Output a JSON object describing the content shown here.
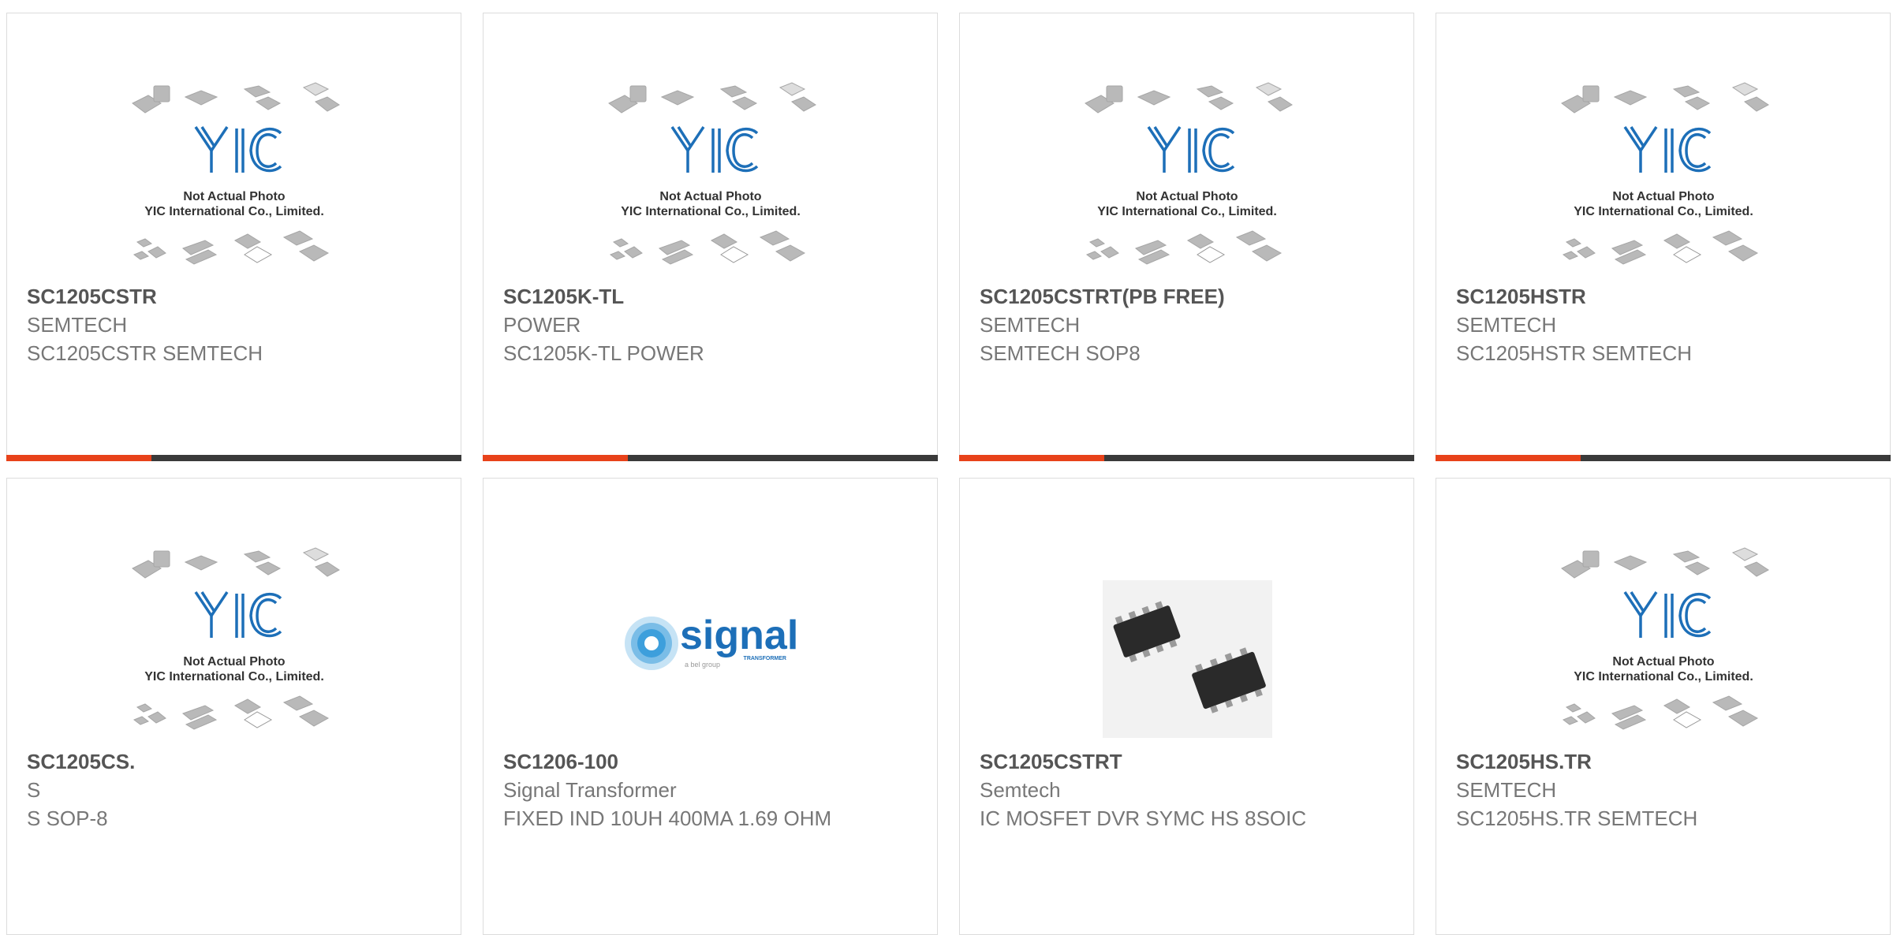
{
  "placeholder_image": {
    "line1": "Not Actual Photo",
    "line2": "YIC International Co., Limited.",
    "logo_text": "YIC"
  },
  "signal_logo": {
    "word": "signal",
    "sub": "TRANSFORMER",
    "tag": "a bel group"
  },
  "colors": {
    "accent": "#e8421a",
    "bar": "#3a3a3a",
    "logo_blue": "#1d6fb8"
  },
  "products": [
    {
      "part_number": "SC1205CSTR",
      "manufacturer": "SEMTECH",
      "description": "SC1205CSTR SEMTECH",
      "image": "yic-placeholder"
    },
    {
      "part_number": "SC1205K-TL",
      "manufacturer": "POWER",
      "description": "SC1205K-TL POWER",
      "image": "yic-placeholder"
    },
    {
      "part_number": "SC1205CSTRT(PB FREE)",
      "manufacturer": "SEMTECH",
      "description": "SEMTECH SOP8",
      "image": "yic-placeholder"
    },
    {
      "part_number": "SC1205HSTR",
      "manufacturer": "SEMTECH",
      "description": "SC1205HSTR SEMTECH",
      "image": "yic-placeholder"
    },
    {
      "part_number": "SC1205CS.",
      "manufacturer": "S",
      "description": "S SOP-8",
      "image": "yic-placeholder"
    },
    {
      "part_number": "SC1206-100",
      "manufacturer": "Signal Transformer",
      "description": "FIXED IND 10UH 400MA 1.69 OHM",
      "image": "signal-logo"
    },
    {
      "part_number": "SC1205CSTRT",
      "manufacturer": "Semtech",
      "description": "IC MOSFET DVR SYMC HS 8SOIC",
      "image": "soic-chip-photo"
    },
    {
      "part_number": "SC1205HS.TR",
      "manufacturer": "SEMTECH",
      "description": "SC1205HS.TR SEMTECH",
      "image": "yic-placeholder"
    }
  ]
}
